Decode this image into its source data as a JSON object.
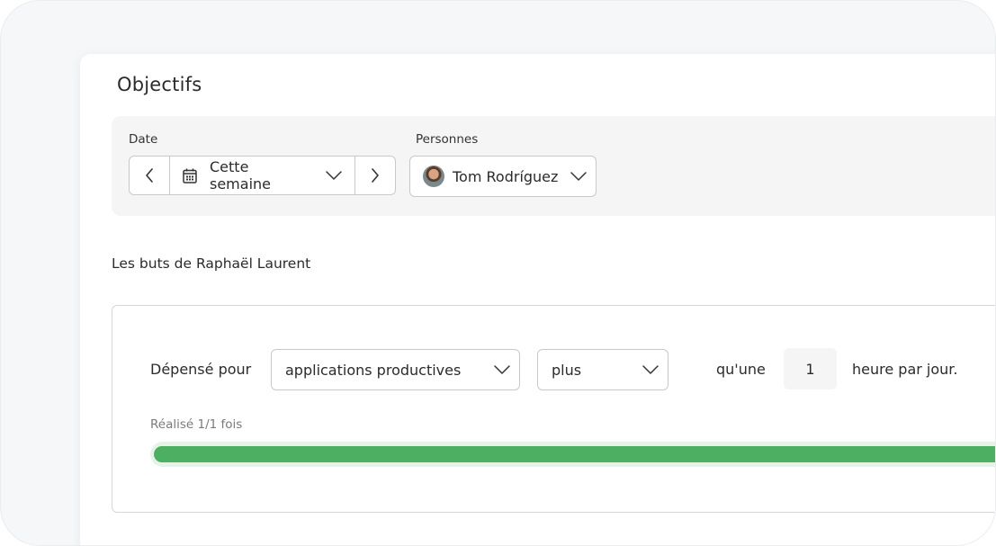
{
  "page": {
    "title": "Objectifs"
  },
  "filters": {
    "date_label": "Date",
    "date_value": "Cette semaine",
    "people_label": "Personnes",
    "person_value": "Tom Rodríguez"
  },
  "goals": {
    "heading": "Les buts de Raphaël Laurent",
    "goal": {
      "prefix": "Dépensé pour",
      "category": "applications productives",
      "comparator": "plus",
      "connector": "qu'une",
      "amount": "1",
      "suffix": "heure par jour.",
      "achieved_text": "Réalisé 1/1 fois",
      "achieved_count": 1,
      "target_count": 1,
      "progress_fraction": 1.0
    }
  },
  "icons": {
    "prev": "chevron-left-icon",
    "next": "chevron-right-icon",
    "calendar": "calendar-icon",
    "dropdown": "chevron-down-icon",
    "avatar": "user-avatar"
  },
  "colors": {
    "progress_fill": "#4caf62",
    "progress_track": "#e6f4e8",
    "filter_bg": "#f5f5f6",
    "border": "#c9c9cd"
  }
}
